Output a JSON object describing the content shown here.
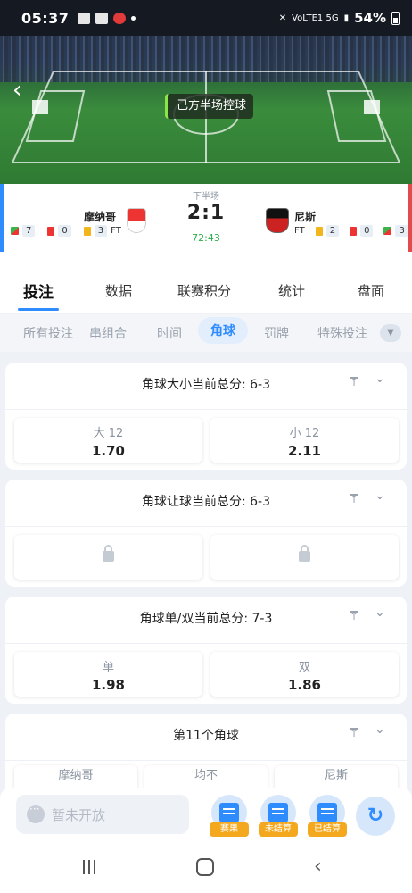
{
  "status_bar": {
    "time": "05:37",
    "network": "VoLTE1 5G",
    "battery": "54%"
  },
  "pitch": {
    "possession_text": "己方半场控球"
  },
  "match": {
    "period": "下半场",
    "score": "2:1",
    "clock": "72:43",
    "home": {
      "name": "摩纳哥",
      "corners": "7",
      "red_cards": "0",
      "yellow_cards": "3",
      "ft_label": "FT"
    },
    "away": {
      "name": "尼斯",
      "corners": "3",
      "red_cards": "0",
      "yellow_cards": "2",
      "ft_label": "FT"
    }
  },
  "main_tabs": [
    "投注",
    "数据",
    "联赛积分",
    "统计",
    "盘面"
  ],
  "sub_tabs": [
    "所有投注",
    "串组合",
    "时间",
    "角球",
    "罚牌",
    "特殊投注"
  ],
  "markets": {
    "ou": {
      "title": "角球大小当前总分: 6-3",
      "over_label": "大 12",
      "over_odds": "1.70",
      "under_label": "小 12",
      "under_odds": "2.11"
    },
    "handicap": {
      "title": "角球让球当前总分: 6-3"
    },
    "odd_even": {
      "title": "角球单/双当前总分: 7-3",
      "odd_label": "单",
      "odd_odds": "1.98",
      "even_label": "双",
      "even_odds": "1.86"
    },
    "next": {
      "title": "第11个角球",
      "home": "摩纳哥",
      "draw": "均不",
      "away": "尼斯"
    }
  },
  "dock": {
    "chat_placeholder": "暂未开放",
    "btn_results": "赛果",
    "btn_unsettled": "未结算",
    "btn_settled": "已结算"
  },
  "colors": {
    "accent": "#2f8cff",
    "tag": "#f4a81e",
    "clock": "#2dae4c"
  }
}
